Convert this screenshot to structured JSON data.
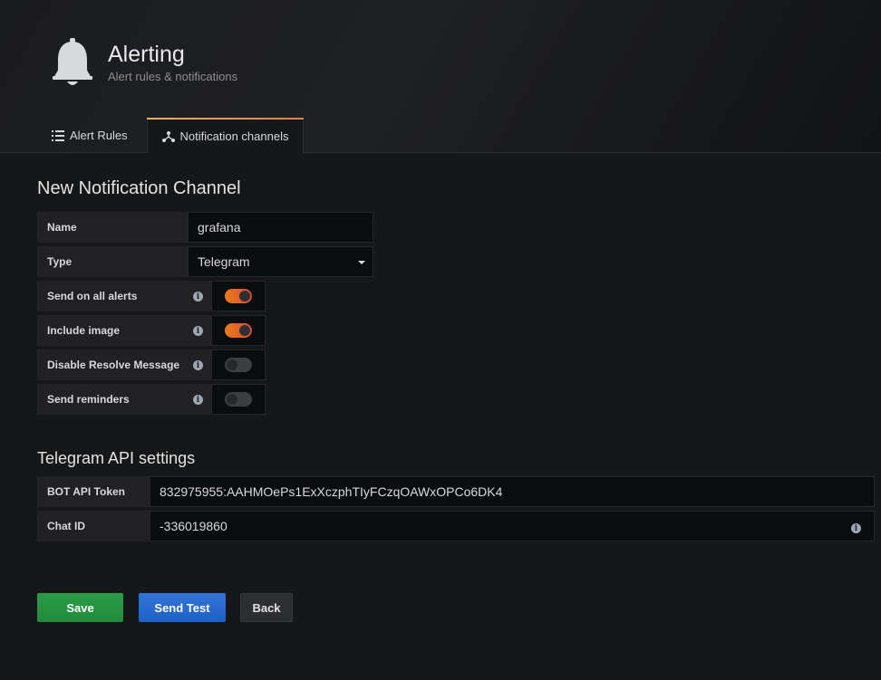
{
  "header": {
    "title": "Alerting",
    "subtitle": "Alert rules & notifications",
    "icon": "bell-icon"
  },
  "tabs": [
    {
      "label": "Alert Rules",
      "icon": "list-icon",
      "active": false
    },
    {
      "label": "Notification channels",
      "icon": "notification-channels-icon",
      "active": true
    }
  ],
  "form": {
    "title": "New Notification Channel",
    "name": {
      "label": "Name",
      "value": "grafana"
    },
    "type": {
      "label": "Type",
      "value": "Telegram"
    },
    "toggles": [
      {
        "label": "Send on all alerts",
        "on": true
      },
      {
        "label": "Include image",
        "on": true
      },
      {
        "label": "Disable Resolve Message",
        "on": false
      },
      {
        "label": "Send reminders",
        "on": false
      }
    ]
  },
  "telegram": {
    "title": "Telegram API settings",
    "bot_token": {
      "label": "BOT API Token",
      "value": "832975955:AAHMOePs1ExXczphTIyFCzqOAWxOPCo6DK4"
    },
    "chat_id": {
      "label": "Chat ID",
      "value": "-336019860"
    }
  },
  "buttons": {
    "save": "Save",
    "send_test": "Send Test",
    "back": "Back"
  },
  "colors": {
    "accent_orange": "#eb7b18",
    "save_green": "#299c46",
    "test_blue": "#3274d9"
  }
}
